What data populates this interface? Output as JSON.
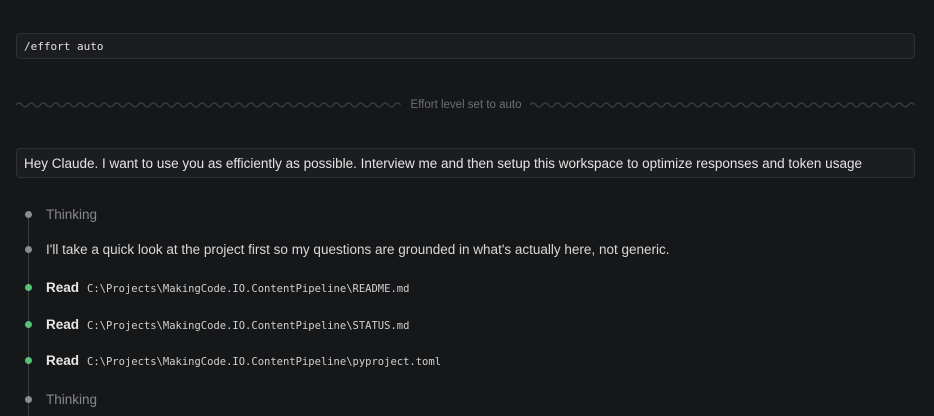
{
  "command": {
    "text": "/effort auto"
  },
  "status_divider": {
    "label": "Effort level set to auto"
  },
  "user_prompt": {
    "text": "Hey Claude.  I want to use you as efficiently as possible.  Interview me and then setup this workspace to optimize responses and token usage"
  },
  "timeline": {
    "thinking_1": "Thinking",
    "assistant_message": "I'll take a quick look at the project first so my questions are grounded in what's actually here, not generic.",
    "reads": [
      {
        "tool": "Read",
        "path": "C:\\Projects\\MakingCode.IO.ContentPipeline\\README.md"
      },
      {
        "tool": "Read",
        "path": "C:\\Projects\\MakingCode.IO.ContentPipeline\\STATUS.md"
      },
      {
        "tool": "Read",
        "path": "C:\\Projects\\MakingCode.IO.ContentPipeline\\pyproject.toml"
      }
    ],
    "thinking_2": "Thinking"
  },
  "colors": {
    "background": "#161719",
    "box_background": "#1c1d20",
    "box_border": "#2e3035",
    "thinking_dot": "#8a8c90",
    "success_dot": "#57c27a",
    "muted_text": "#6d6f74"
  },
  "icons": {
    "divider_wave": "wavy-line",
    "step_dot": "circle-dot"
  }
}
